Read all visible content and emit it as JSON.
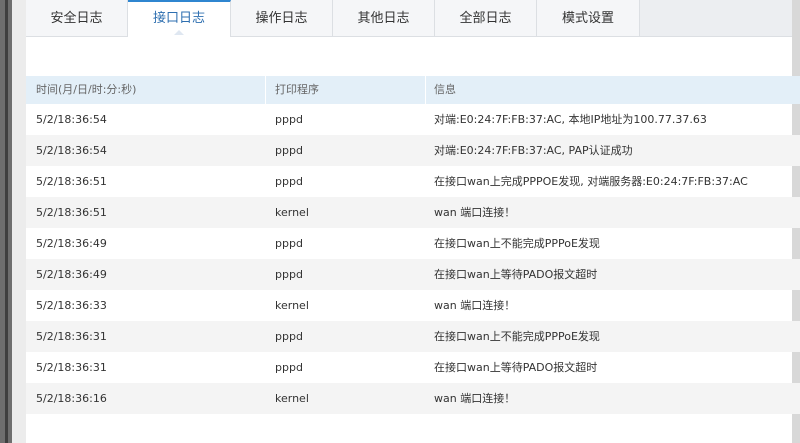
{
  "tabs": [
    {
      "label": "安全日志",
      "active": false
    },
    {
      "label": "接口日志",
      "active": true
    },
    {
      "label": "操作日志",
      "active": false
    },
    {
      "label": "其他日志",
      "active": false
    },
    {
      "label": "全部日志",
      "active": false
    },
    {
      "label": "模式设置",
      "active": false
    }
  ],
  "table": {
    "headers": {
      "time": "时间(月/日/时:分:秒)",
      "program": "打印程序",
      "info": "信息"
    },
    "rows": [
      {
        "time": "5/2/18:36:54",
        "program": "pppd",
        "info": "对端:E0:24:7F:FB:37:AC, 本地IP地址为100.77.37.63"
      },
      {
        "time": "5/2/18:36:54",
        "program": "pppd",
        "info": "对端:E0:24:7F:FB:37:AC, PAP认证成功"
      },
      {
        "time": "5/2/18:36:51",
        "program": "pppd",
        "info": "在接口wan上完成PPPOE发现, 对端服务器:E0:24:7F:FB:37:AC"
      },
      {
        "time": "5/2/18:36:51",
        "program": "kernel",
        "info": "wan 端口连接！"
      },
      {
        "time": "5/2/18:36:49",
        "program": "pppd",
        "info": "在接口wan上不能完成PPPoE发现"
      },
      {
        "time": "5/2/18:36:49",
        "program": "pppd",
        "info": "在接口wan上等待PADO报文超时"
      },
      {
        "time": "5/2/18:36:33",
        "program": "kernel",
        "info": "wan 端口连接！"
      },
      {
        "time": "5/2/18:36:31",
        "program": "pppd",
        "info": "在接口wan上不能完成PPPoE发现"
      },
      {
        "time": "5/2/18:36:31",
        "program": "pppd",
        "info": "在接口wan上等待PADO报文超时"
      },
      {
        "time": "5/2/18:36:16",
        "program": "kernel",
        "info": "wan 端口连接！"
      }
    ]
  },
  "colors": {
    "active_tab_text": "#2e6fb0",
    "active_tab_border": "#2f86d0",
    "header_bg": "#e3eff8",
    "alt_row_bg": "#f4f4f4"
  }
}
